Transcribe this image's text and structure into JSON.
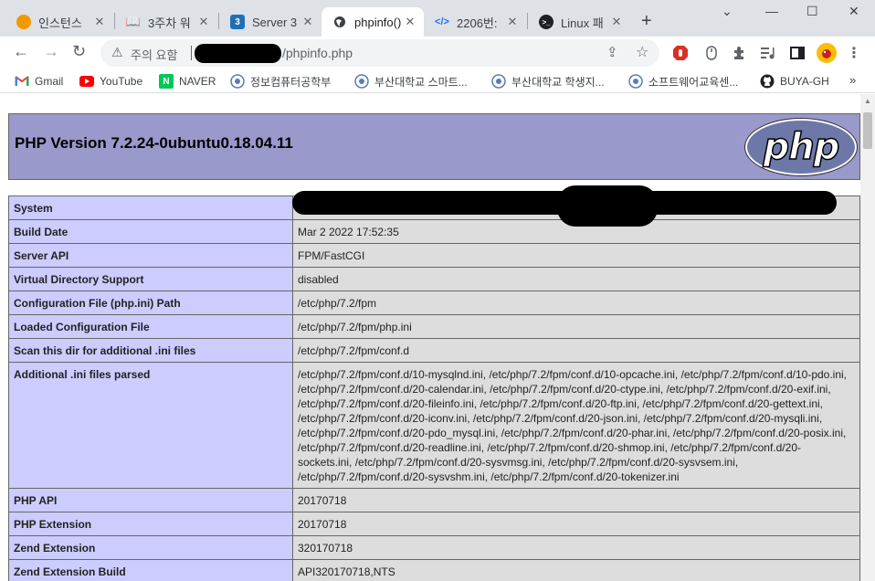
{
  "browser": {
    "tabs": [
      {
        "title": "인스턴스",
        "favicon": "orange-circle-icon",
        "color": "#f29900"
      },
      {
        "title": "3주차 워",
        "favicon": "book-icon",
        "color": "#5f6368"
      },
      {
        "title": "Server 3",
        "favicon": "3-icon",
        "color": "#1f6fb5"
      },
      {
        "title": "phpinfo()",
        "favicon": "globe-icon",
        "color": "#3c4043"
      },
      {
        "title": "2206번:",
        "favicon": "code-icon",
        "color": "#1a73e8"
      },
      {
        "title": "Linux 패",
        "favicon": "terminal-icon",
        "color": "#202124"
      }
    ],
    "new_tab": "+",
    "window_controls": {
      "collapse": "⌄",
      "minimize": "—",
      "maximize": "☐",
      "close": "✕"
    },
    "nav": {
      "back": "←",
      "forward": "→",
      "reload": "↻"
    },
    "address": {
      "security_icon": "warning-icon",
      "security_label": "주의 요함",
      "url_visible": "/phpinfo.php"
    },
    "bookmarks": [
      {
        "label": "Gmail",
        "icon": "gmail-icon"
      },
      {
        "label": "YouTube",
        "icon": "youtube-icon"
      },
      {
        "label": "NAVER",
        "icon": "naver-icon"
      },
      {
        "label": "정보컴퓨터공학부",
        "icon": "pnu-icon"
      },
      {
        "label": "부산대학교 스마트...",
        "icon": "pnu-icon"
      },
      {
        "label": "부산대학교 학생지...",
        "icon": "pnu-icon"
      },
      {
        "label": "소프트웨어교육센...",
        "icon": "pnu-icon"
      },
      {
        "label": "BUYA-GH",
        "icon": "github-icon"
      }
    ],
    "bookmarks_more": "»"
  },
  "page": {
    "title": "PHP Version 7.2.24-0ubuntu0.18.04.11",
    "logo_text": "php",
    "rows": [
      {
        "key": "System",
        "value": ""
      },
      {
        "key": "Build Date",
        "value": "Mar 2 2022 17:52:35"
      },
      {
        "key": "Server API",
        "value": "FPM/FastCGI"
      },
      {
        "key": "Virtual Directory Support",
        "value": "disabled"
      },
      {
        "key": "Configuration File (php.ini) Path",
        "value": "/etc/php/7.2/fpm"
      },
      {
        "key": "Loaded Configuration File",
        "value": "/etc/php/7.2/fpm/php.ini"
      },
      {
        "key": "Scan this dir for additional .ini files",
        "value": "/etc/php/7.2/fpm/conf.d"
      },
      {
        "key": "Additional .ini files parsed",
        "value": "/etc/php/7.2/fpm/conf.d/10-mysqlnd.ini, /etc/php/7.2/fpm/conf.d/10-opcache.ini, /etc/php/7.2/fpm/conf.d/10-pdo.ini, /etc/php/7.2/fpm/conf.d/20-calendar.ini, /etc/php/7.2/fpm/conf.d/20-ctype.ini, /etc/php/7.2/fpm/conf.d/20-exif.ini, /etc/php/7.2/fpm/conf.d/20-fileinfo.ini, /etc/php/7.2/fpm/conf.d/20-ftp.ini, /etc/php/7.2/fpm/conf.d/20-gettext.ini, /etc/php/7.2/fpm/conf.d/20-iconv.ini, /etc/php/7.2/fpm/conf.d/20-json.ini, /etc/php/7.2/fpm/conf.d/20-mysqli.ini, /etc/php/7.2/fpm/conf.d/20-pdo_mysql.ini, /etc/php/7.2/fpm/conf.d/20-phar.ini, /etc/php/7.2/fpm/conf.d/20-posix.ini, /etc/php/7.2/fpm/conf.d/20-readline.ini, /etc/php/7.2/fpm/conf.d/20-shmop.ini, /etc/php/7.2/fpm/conf.d/20-sockets.ini, /etc/php/7.2/fpm/conf.d/20-sysvmsg.ini, /etc/php/7.2/fpm/conf.d/20-sysvsem.ini, /etc/php/7.2/fpm/conf.d/20-sysvshm.ini, /etc/php/7.2/fpm/conf.d/20-tokenizer.ini"
      },
      {
        "key": "PHP API",
        "value": "20170718"
      },
      {
        "key": "PHP Extension",
        "value": "20170718"
      },
      {
        "key": "Zend Extension",
        "value": "320170718"
      },
      {
        "key": "Zend Extension Build",
        "value": "API320170718,NTS"
      }
    ]
  },
  "colors": {
    "header_bg": "#9999cc",
    "key_bg": "#ccccff",
    "value_bg": "#dddddd"
  }
}
